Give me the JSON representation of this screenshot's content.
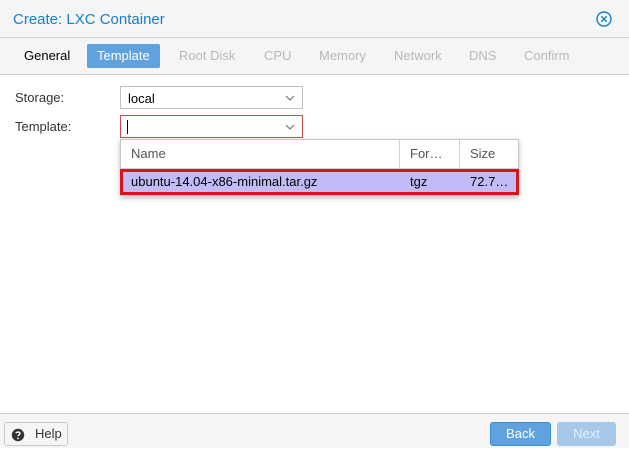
{
  "window": {
    "title": "Create: LXC Container"
  },
  "tabs": [
    {
      "label": "General",
      "state": "enabled"
    },
    {
      "label": "Template",
      "state": "active"
    },
    {
      "label": "Root Disk",
      "state": "disabled"
    },
    {
      "label": "CPU",
      "state": "disabled"
    },
    {
      "label": "Memory",
      "state": "disabled"
    },
    {
      "label": "Network",
      "state": "disabled"
    },
    {
      "label": "DNS",
      "state": "disabled"
    },
    {
      "label": "Confirm",
      "state": "disabled"
    }
  ],
  "form": {
    "storage": {
      "label": "Storage:",
      "value": "local"
    },
    "template": {
      "label": "Template:",
      "value": ""
    }
  },
  "template_picker": {
    "columns": [
      "Name",
      "For…",
      "Size"
    ],
    "rows": [
      {
        "name": "ubuntu-14.04-x86-minimal.tar.gz",
        "format": "tgz",
        "size": "72.7…",
        "selected": true
      }
    ]
  },
  "footer": {
    "help_label": "Help",
    "back_label": "Back",
    "next_label": "Next"
  },
  "colors": {
    "accent": "#5fa2dd",
    "title": "#157fcc",
    "highlight_row": "#c1bcf8",
    "highlight_border": "#d9131b"
  },
  "icons": {
    "close": "close-circle-icon",
    "help": "question-circle-icon",
    "dropdown": "chevron-down-icon"
  }
}
